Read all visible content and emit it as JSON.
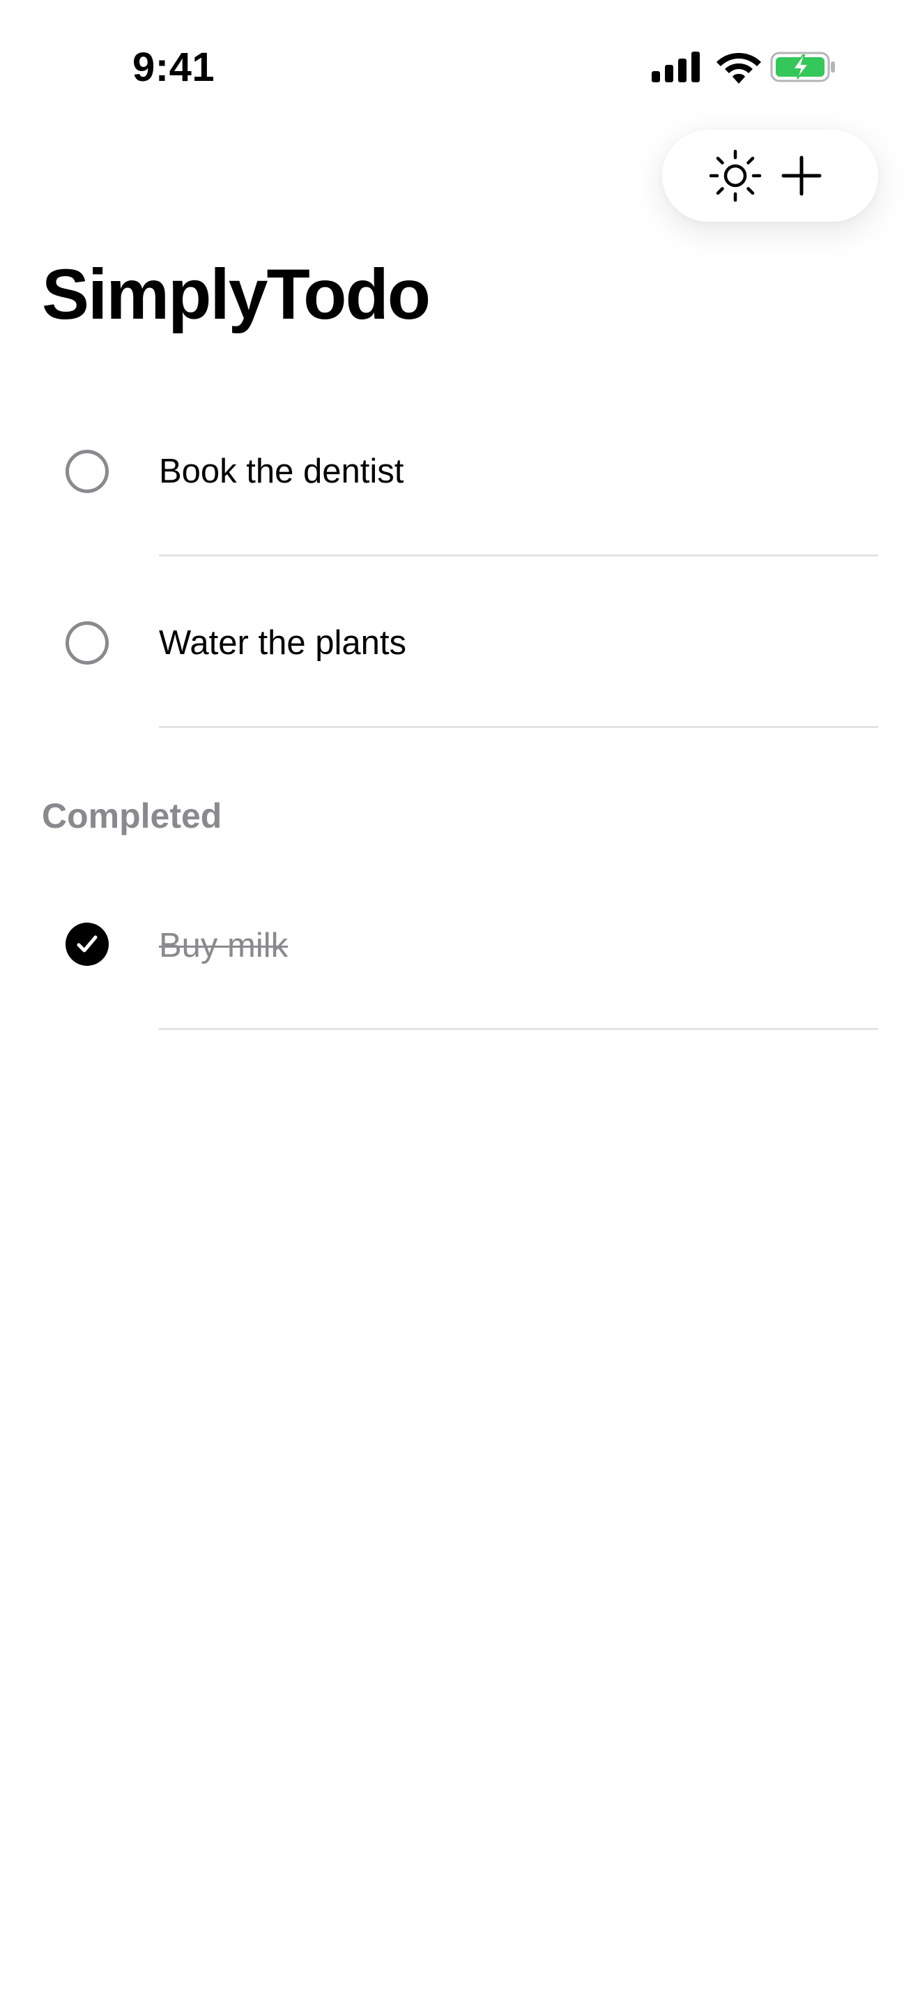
{
  "status_bar": {
    "time": "9:41",
    "icons": [
      "cellular-signal-icon",
      "wifi-icon",
      "battery-charging-icon"
    ],
    "battery_color": "#34c759"
  },
  "toolbar": {
    "buttons": [
      {
        "icon": "sun-icon",
        "action": "toggle-theme"
      },
      {
        "icon": "plus-icon",
        "action": "add-todo"
      }
    ]
  },
  "app": {
    "title": "SimplyTodo"
  },
  "todos": {
    "active": [
      {
        "label": "Book the dentist",
        "completed": false
      },
      {
        "label": "Water the plants",
        "completed": false
      }
    ],
    "completed_header": "Completed",
    "completed": [
      {
        "label": "Buy milk",
        "completed": true
      }
    ]
  },
  "colors": {
    "accent": "#000000",
    "secondary_text": "#8a8a8e",
    "divider": "#e3e3e6",
    "background": "#ffffff"
  }
}
